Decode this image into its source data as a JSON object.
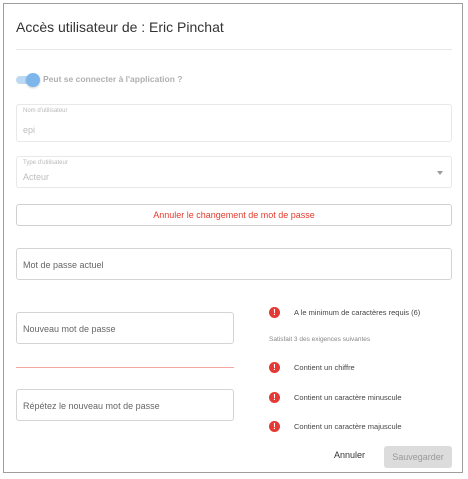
{
  "dialog": {
    "title": "Accès utilisateur de : Eric Pinchat"
  },
  "toggle": {
    "label": "Peut se connecter à l'application ?",
    "state": "on",
    "accent_color": "#7cb6ea"
  },
  "username": {
    "label": "Nom d'utilisateur",
    "value": "epi"
  },
  "user_type": {
    "label": "Type d'utilisateur",
    "value": "Acteur"
  },
  "cancel_password_change": {
    "label": "Annuler le changement de mot de passe",
    "color": "#e33b2e"
  },
  "fields": {
    "current_password": "Mot de passe actuel",
    "new_password": "Nouveau mot de passe",
    "repeat_password": "Répétez le nouveau mot de passe"
  },
  "requirements": {
    "min_chars": "A le minimum de caractères requis (6)",
    "note": "Satisfait 3 des exigences suivantes",
    "digit": "Contient un chiffre",
    "lowercase": "Contient un caractère minuscule",
    "uppercase": "Contient un caractère majuscule",
    "status_icon": "error-icon",
    "error_color": "#e53935"
  },
  "footer": {
    "cancel_label": "Annuler",
    "save_label": "Sauvegarder"
  }
}
